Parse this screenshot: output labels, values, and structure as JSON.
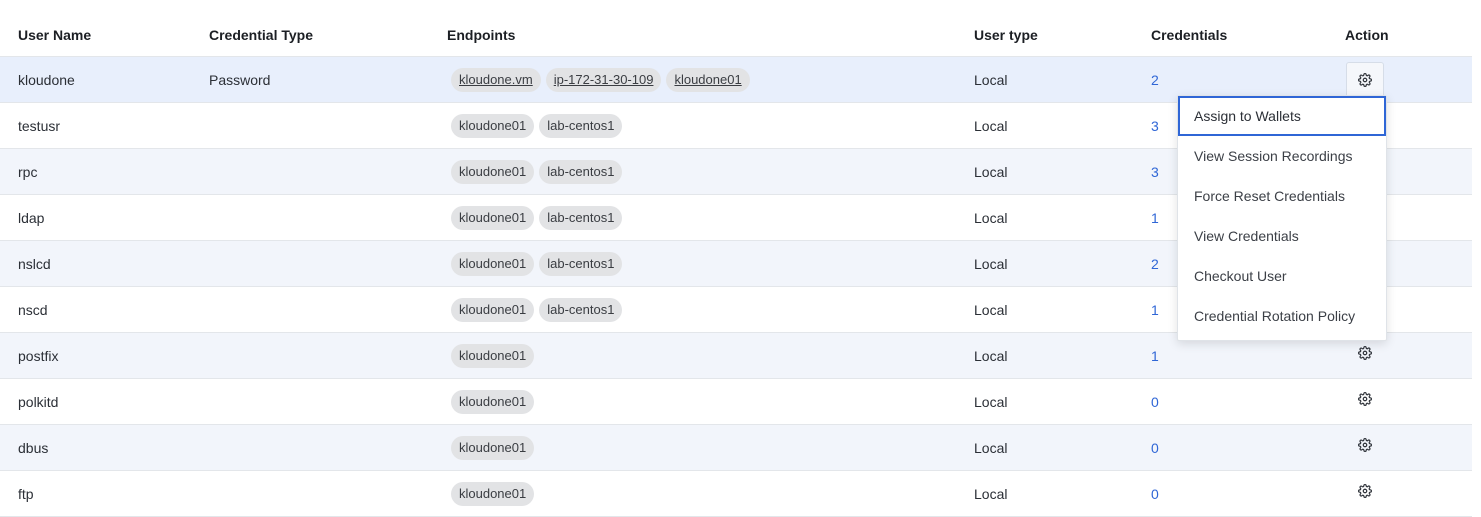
{
  "columns": {
    "user_name": "User Name",
    "credential_type": "Credential Type",
    "endpoints": "Endpoints",
    "user_type": "User type",
    "credentials": "Credentials",
    "action": "Action"
  },
  "rows": [
    {
      "user": "kloudone",
      "cred_type": "Password",
      "endpoints": [
        "kloudone.vm",
        "ip-172-31-30-109",
        "kloudone01"
      ],
      "user_type": "Local",
      "credentials": "2"
    },
    {
      "user": "testusr",
      "cred_type": "",
      "endpoints": [
        "kloudone01",
        "lab-centos1"
      ],
      "user_type": "Local",
      "credentials": "3"
    },
    {
      "user": "rpc",
      "cred_type": "",
      "endpoints": [
        "kloudone01",
        "lab-centos1"
      ],
      "user_type": "Local",
      "credentials": "3"
    },
    {
      "user": "ldap",
      "cred_type": "",
      "endpoints": [
        "kloudone01",
        "lab-centos1"
      ],
      "user_type": "Local",
      "credentials": "1"
    },
    {
      "user": "nslcd",
      "cred_type": "",
      "endpoints": [
        "kloudone01",
        "lab-centos1"
      ],
      "user_type": "Local",
      "credentials": "2"
    },
    {
      "user": "nscd",
      "cred_type": "",
      "endpoints": [
        "kloudone01",
        "lab-centos1"
      ],
      "user_type": "Local",
      "credentials": "1"
    },
    {
      "user": "postfix",
      "cred_type": "",
      "endpoints": [
        "kloudone01"
      ],
      "user_type": "Local",
      "credentials": "1"
    },
    {
      "user": "polkitd",
      "cred_type": "",
      "endpoints": [
        "kloudone01"
      ],
      "user_type": "Local",
      "credentials": "0"
    },
    {
      "user": "dbus",
      "cred_type": "",
      "endpoints": [
        "kloudone01"
      ],
      "user_type": "Local",
      "credentials": "0"
    },
    {
      "user": "ftp",
      "cred_type": "",
      "endpoints": [
        "kloudone01"
      ],
      "user_type": "Local",
      "credentials": "0"
    }
  ],
  "action_menu": {
    "items": [
      "Assign to Wallets",
      "View Session Recordings",
      "Force Reset Credentials",
      "View Credentials",
      "Checkout User",
      "Credential Rotation Policy"
    ]
  },
  "icons": {
    "action": "gear-icon"
  },
  "colors": {
    "accent": "#2f66d6",
    "row_alt": "#f2f5fb",
    "chip_bg": "#e2e3e5"
  }
}
